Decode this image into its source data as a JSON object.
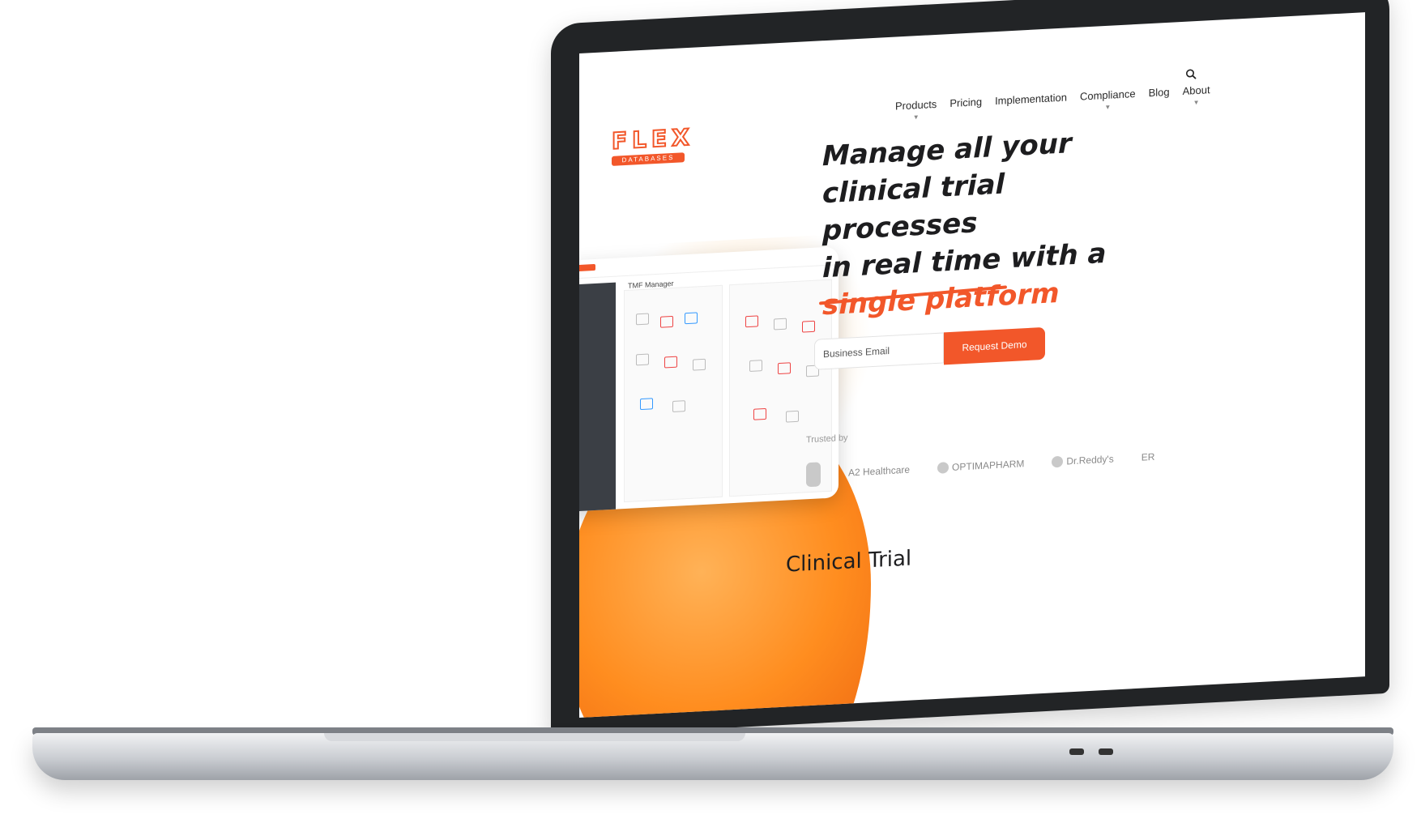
{
  "site": {
    "logo": {
      "main": "FLEX",
      "sub": "DATABASES"
    },
    "nav": [
      {
        "label": "Products",
        "chevron": true
      },
      {
        "label": "Pricing",
        "chevron": false
      },
      {
        "label": "Implementation",
        "chevron": false
      },
      {
        "label": "Compliance",
        "chevron": true
      },
      {
        "label": "Blog",
        "chevron": false
      },
      {
        "label": "About",
        "chevron": true
      }
    ],
    "hero": {
      "line1": "Manage all your",
      "line2": "clinical trial processes",
      "line3": "in real time with a",
      "accent": "single platform"
    },
    "form": {
      "email_placeholder": "Business Email",
      "button_label": "Request Demo"
    },
    "trusted_label": "Trusted by",
    "brands": [
      "A2 Healthcare",
      "OPTIMAPHARM",
      "Dr.Reddy's",
      "ER"
    ],
    "mockup_title": "TMF Manager",
    "section_title": "Clinical Trial"
  },
  "colors": {
    "accent": "#f2572a",
    "orange": "#ff8d1f",
    "bezel": "#222426"
  },
  "icons": {
    "search": "search-icon",
    "chevron": "chevron-down-icon"
  }
}
